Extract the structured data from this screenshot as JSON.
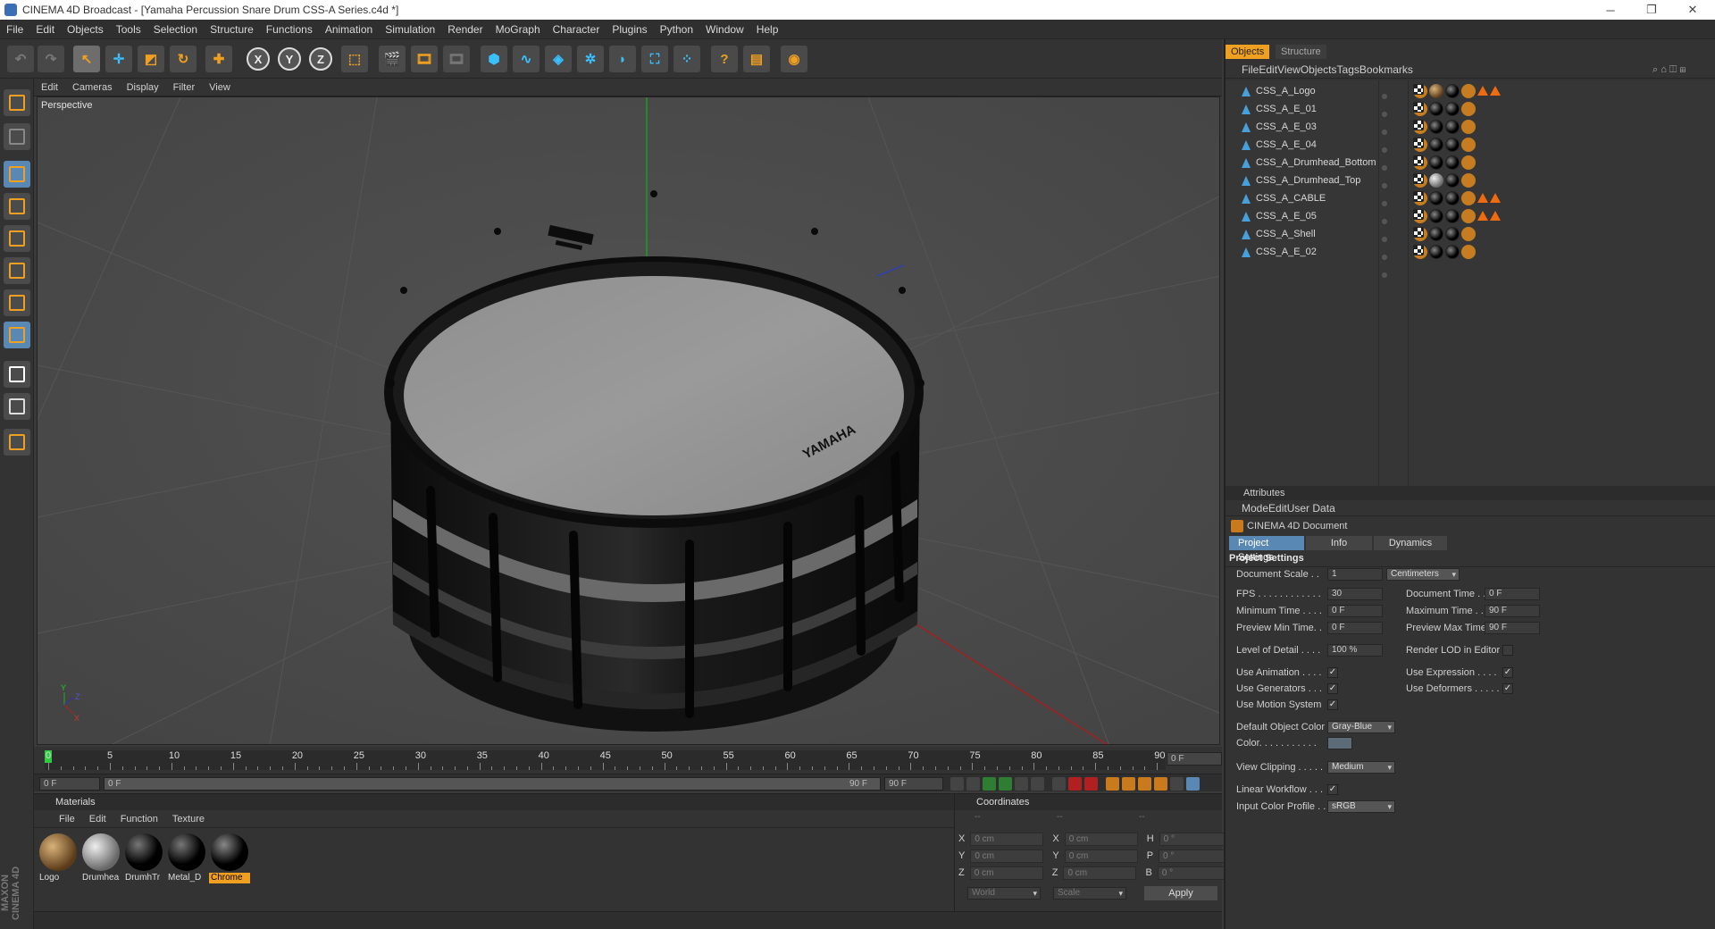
{
  "window": {
    "title": "CINEMA 4D Broadcast - [Yamaha Percussion Snare Drum CSS-A Series.c4d *]",
    "minimize": "─",
    "maximize": "❐",
    "close": "✕"
  },
  "menubar": [
    "File",
    "Edit",
    "Objects",
    "Tools",
    "Selection",
    "Structure",
    "Functions",
    "Animation",
    "Simulation",
    "Render",
    "MoGraph",
    "Character",
    "Plugins",
    "Python",
    "Window",
    "Help"
  ],
  "toolbar": {
    "axis_x": "X",
    "axis_y": "Y",
    "axis_z": "Z"
  },
  "viewport": {
    "menu": [
      "Edit",
      "Cameras",
      "Display",
      "Filter",
      "View"
    ],
    "label": "Perspective",
    "brand_top": "YAMAHA",
    "brand_side": "YAMAHA",
    "gizmo_y": "Y",
    "gizmo_z": "Z",
    "gizmo_x": "X"
  },
  "timeline": {
    "ticks": [
      "0",
      "5",
      "10",
      "15",
      "20",
      "25",
      "30",
      "35",
      "40",
      "45",
      "50",
      "55",
      "60",
      "65",
      "70",
      "75",
      "80",
      "85",
      "90"
    ],
    "current_frame": "0 F",
    "start_field": "0 F",
    "range_start": "0 F",
    "range_end": "90 F",
    "end_field": "90 F"
  },
  "materials": {
    "title": "Materials",
    "menu": [
      "File",
      "Edit",
      "Function",
      "Texture"
    ],
    "items": [
      {
        "label": "Logo",
        "selected": false
      },
      {
        "label": "Drumhea",
        "selected": false
      },
      {
        "label": "DrumhTr",
        "selected": false
      },
      {
        "label": "Metal_D",
        "selected": false
      },
      {
        "label": "Chrome",
        "selected": true
      }
    ]
  },
  "coordinates": {
    "title": "Coordinates",
    "col_headers": [
      "--",
      "--",
      "--"
    ],
    "rows": [
      {
        "a": "X",
        "av": "0 cm",
        "b": "X",
        "bv": "0 cm",
        "c": "H",
        "cv": "0 °"
      },
      {
        "a": "Y",
        "av": "0 cm",
        "b": "Y",
        "bv": "0 cm",
        "c": "P",
        "cv": "0 °"
      },
      {
        "a": "Z",
        "av": "0 cm",
        "b": "Z",
        "bv": "0 cm",
        "c": "B",
        "cv": "0 °"
      }
    ],
    "space": "World",
    "mode": "Scale",
    "apply": "Apply"
  },
  "maxon": "MAXON CINEMA 4D",
  "objects_panel": {
    "tabs": [
      "Objects",
      "Structure"
    ],
    "menu": [
      "File",
      "Edit",
      "View",
      "Objects",
      "Tags",
      "Bookmarks"
    ],
    "items": [
      {
        "name": "CSS_A_Logo",
        "mat": "bbrown",
        "tri": 2
      },
      {
        "name": "CSS_A_E_01",
        "mat": "ball",
        "tri": 0
      },
      {
        "name": "CSS_A_E_03",
        "mat": "ball",
        "tri": 0
      },
      {
        "name": "CSS_A_E_04",
        "mat": "ball",
        "tri": 0
      },
      {
        "name": "CSS_A_Drumhead_Bottom",
        "mat": "ball",
        "tri": 0
      },
      {
        "name": "CSS_A_Drumhead_Top",
        "mat": "ballg",
        "tri": 0
      },
      {
        "name": "CSS_A_CABLE",
        "mat": "ball",
        "tri": 2
      },
      {
        "name": "CSS_A_E_05",
        "mat": "ball",
        "tri": 2
      },
      {
        "name": "CSS_A_Shell",
        "mat": "ball",
        "tri": 0
      },
      {
        "name": "CSS_A_E_02",
        "mat": "ball",
        "tri": 0
      }
    ]
  },
  "attributes": {
    "title": "Attributes",
    "menu": [
      "Mode",
      "Edit",
      "User Data"
    ],
    "doc": "CINEMA 4D Document",
    "tabs": [
      "Project Settings",
      "Info",
      "Dynamics"
    ],
    "section": "Project Settings",
    "document_scale_label": "Document Scale . .",
    "document_scale": "1",
    "units": "Centimeters",
    "fps_label": "FPS . . . . . . . . . . . .",
    "fps": "30",
    "doc_time_label": "Document Time . .",
    "doc_time": "0 F",
    "min_time_label": "Minimum Time . . . .",
    "min_time": "0 F",
    "max_time_label": "Maximum Time . . . . .",
    "max_time": "90 F",
    "prev_min_label": "Preview Min Time. .",
    "prev_min": "0 F",
    "prev_max_label": "Preview Max Time . .",
    "prev_max": "90 F",
    "lod_label": "Level of Detail . . . .",
    "lod": "100 %",
    "render_lod_label": "Render LOD in Editor",
    "use_animation_label": "Use Animation . . . .",
    "use_expression_label": "Use Expression . . . .",
    "use_generators_label": "Use Generators . . .",
    "use_deformers_label": "Use Deformers . . . . .",
    "use_motion_label": "Use Motion System",
    "default_color_label": "Default Object Color",
    "default_color": "Gray-Blue",
    "color_label": "Color. . . . . . . . . . .",
    "view_clipping_label": "View Clipping . . . . .",
    "view_clipping": "Medium",
    "linear_workflow_label": "Linear Workflow . . .",
    "input_profile_label": "Input Color Profile . .",
    "input_profile": "sRGB",
    "check": "✓"
  }
}
